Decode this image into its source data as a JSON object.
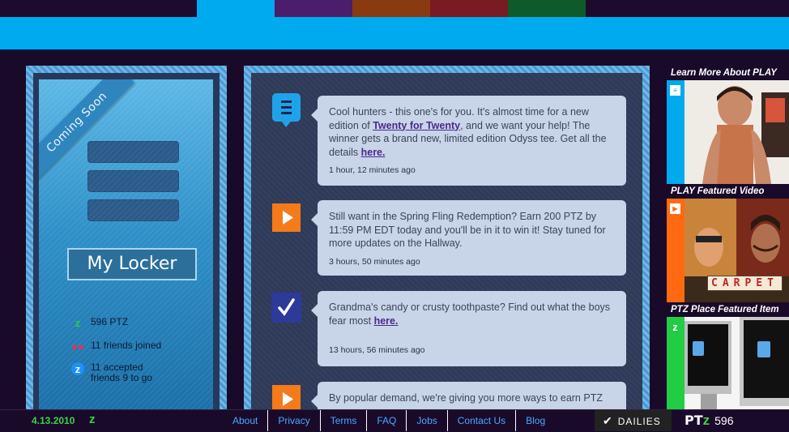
{
  "top_tabs": [
    {
      "color": "#00aaee"
    },
    {
      "color": "#4a1e6a"
    },
    {
      "color": "#8a3a10"
    },
    {
      "color": "#7a1a22"
    },
    {
      "color": "#0f5a2a"
    }
  ],
  "locker": {
    "ribbon_label": "Coming Soon",
    "button_label": "My Locker",
    "stats": [
      {
        "icon": "ptz-z-icon",
        "text": "596 PTZ"
      },
      {
        "icon": "friends-icon",
        "text": "11 friends joined"
      },
      {
        "icon": "accepted-z-icon",
        "text": "11 accepted friends 9 to go",
        "line1": "11 accepted",
        "line2": "friends 9 to go"
      }
    ]
  },
  "feed": [
    {
      "icon": "hallway-list-icon",
      "text_before": "Cool hunters - this one's for you. It's almost time for a new edition of ",
      "link1": "Twenty for Twenty",
      "text_middle": ", and we want your help! The winner gets a brand new, limited edition Odyss tee. Get all the details ",
      "link2": "here.",
      "time": "1 hour, 12 minutes ago"
    },
    {
      "icon": "play-icon",
      "text": "Still want in the Spring Fling Redemption? Earn 200 PTZ by 11:59 PM EDT today and you'll be in it to win it! Stay tuned for more updates on the Hallway.",
      "time": "3 hours, 50 minutes ago"
    },
    {
      "icon": "check-icon",
      "text": "Grandma's candy or crusty toothpaste? Find out what the boys fear most ",
      "link": "here.",
      "time": "13 hours, 56 minutes ago"
    },
    {
      "icon": "play-icon",
      "text": "By popular demand, we're giving you more ways to earn PTZ"
    }
  ],
  "right_column": {
    "sections": [
      {
        "title": "Learn More About PLAY",
        "strip_color": "#00aaee",
        "badge": "hallway-badge-icon"
      },
      {
        "title": "PLAY Featured Video",
        "strip_color": "#ff6a10",
        "badge": "play-badge-icon",
        "caption": "CARPET"
      },
      {
        "title": "PTZ Place Featured Item",
        "strip_color": "#22cc44",
        "badge": "ptz-badge-icon"
      }
    ]
  },
  "footer": {
    "date": "4.13.2010",
    "links": [
      "About",
      "Privacy",
      "Terms",
      "FAQ",
      "Jobs",
      "Contact Us",
      "Blog"
    ],
    "dailies_label": "DAILIES",
    "ptz_label": "PT",
    "ptz_value": "596"
  }
}
